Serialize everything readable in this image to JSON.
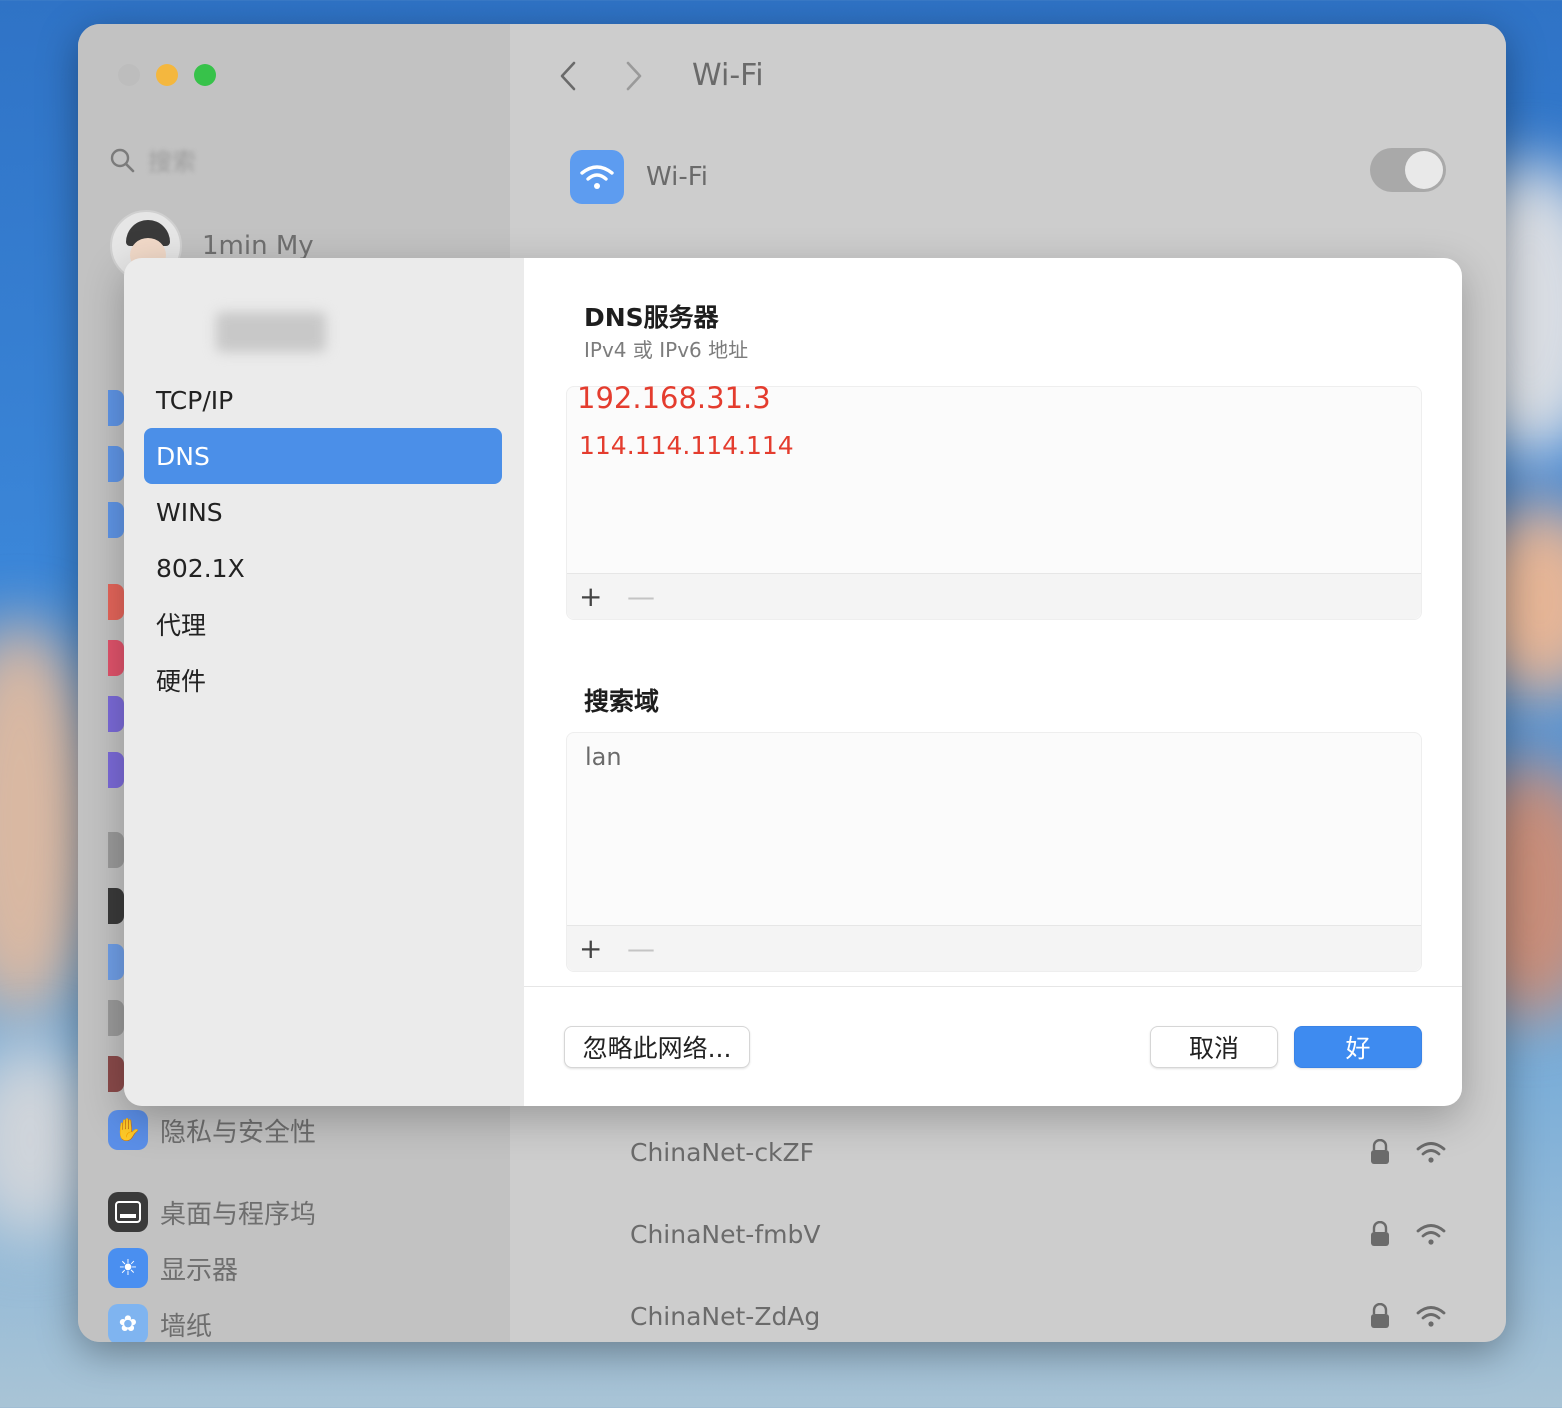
{
  "window": {
    "nav_title": "Wi-Fi",
    "search_placeholder": "搜索",
    "user_name": "1min My",
    "wifi_label": "Wi-Fi"
  },
  "sidebar_bottom": [
    {
      "label": "隐私与安全性",
      "icon": "hand-icon",
      "color": "#5b8fe8"
    },
    {
      "label": "桌面与程序坞",
      "icon": "dock-icon",
      "color": "#3a3a3a"
    },
    {
      "label": "显示器",
      "icon": "sun-icon",
      "color": "#4a8ff0"
    },
    {
      "label": "墙纸",
      "icon": "flower-icon",
      "color": "#7fb4f0"
    }
  ],
  "networks": [
    {
      "name": "ChinaNet-ckZF"
    },
    {
      "name": "ChinaNet-fmbV"
    },
    {
      "name": "ChinaNet-ZdAg"
    }
  ],
  "dialog": {
    "sidebar_items": [
      {
        "label": "TCP/IP"
      },
      {
        "label": "DNS"
      },
      {
        "label": "WINS"
      },
      {
        "label": "802.1X"
      },
      {
        "label": "代理"
      },
      {
        "label": "硬件"
      }
    ],
    "dns_section": {
      "title": "DNS服务器",
      "subtitle": "IPv4 或 IPv6 地址",
      "servers": [
        "192.168.31.3",
        "114.114.114.114"
      ]
    },
    "search_section": {
      "title": "搜索域",
      "domains": [
        "lan"
      ]
    },
    "list_add": "+",
    "list_remove": "—",
    "buttons": {
      "ignore": "忽略此网络...",
      "cancel": "取消",
      "ok": "好"
    }
  },
  "colors": {
    "accent": "#4b8fe8",
    "dns_text": "#e43c2e"
  }
}
